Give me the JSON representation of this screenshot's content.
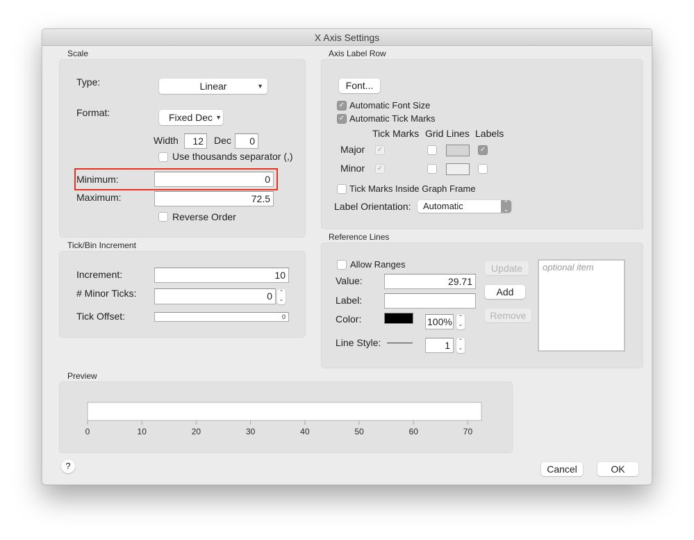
{
  "window": {
    "title": "X Axis Settings"
  },
  "scale": {
    "group_label": "Scale",
    "type_label": "Type:",
    "type_value": "Linear",
    "format_label": "Format:",
    "format_value": "Fixed Dec",
    "width_label": "Width",
    "width_value": "12",
    "dec_label": "Dec",
    "dec_value": "0",
    "thousands_label": "Use thousands separator (,)",
    "thousands_checked": false,
    "minimum_label": "Minimum:",
    "minimum_value": "0",
    "maximum_label": "Maximum:",
    "maximum_value": "72.5",
    "reverse_label": "Reverse Order",
    "reverse_checked": false
  },
  "tick_bin": {
    "group_label": "Tick/Bin Increment",
    "increment_label": "Increment:",
    "increment_value": "10",
    "minor_ticks_label": "# Minor Ticks:",
    "minor_ticks_value": "0",
    "tick_offset_label": "Tick Offset:",
    "tick_offset_value": "0"
  },
  "axis_label_row": {
    "group_label": "Axis Label Row",
    "font_button": "Font...",
    "auto_font_size_label": "Automatic Font Size",
    "auto_font_size_checked": true,
    "auto_tick_marks_label": "Automatic Tick Marks",
    "auto_tick_marks_checked": true,
    "col_tick_marks": "Tick Marks",
    "col_grid_lines": "Grid Lines",
    "col_labels": "Labels",
    "major_label": "Major",
    "minor_label": "Minor",
    "major": {
      "tick_marks": true,
      "grid_lines": false,
      "grid_color": "#d4d4d4",
      "labels": true
    },
    "minor": {
      "tick_marks": true,
      "grid_lines": false,
      "grid_color": "#efefef",
      "labels": false
    },
    "inside_frame_label": "Tick Marks Inside Graph Frame",
    "inside_frame_checked": false,
    "orientation_label": "Label Orientation:",
    "orientation_value": "Automatic"
  },
  "reference_lines": {
    "group_label": "Reference Lines",
    "allow_ranges_label": "Allow Ranges",
    "allow_ranges_checked": false,
    "value_label": "Value:",
    "value_value": "29.71",
    "label_label": "Label:",
    "label_value": "",
    "color_label": "Color:",
    "color_value": "#000000",
    "opacity_value": "100%",
    "line_style_label": "Line Style:",
    "line_width_value": "1",
    "update_button": "Update",
    "add_button": "Add",
    "remove_button": "Remove",
    "list_placeholder": "optional item"
  },
  "preview": {
    "group_label": "Preview",
    "axis_min": 0,
    "axis_max": 72.5,
    "ticks": [
      0,
      10,
      20,
      30,
      40,
      50,
      60,
      70
    ]
  },
  "footer": {
    "help_button": "?",
    "cancel_button": "Cancel",
    "ok_button": "OK"
  }
}
